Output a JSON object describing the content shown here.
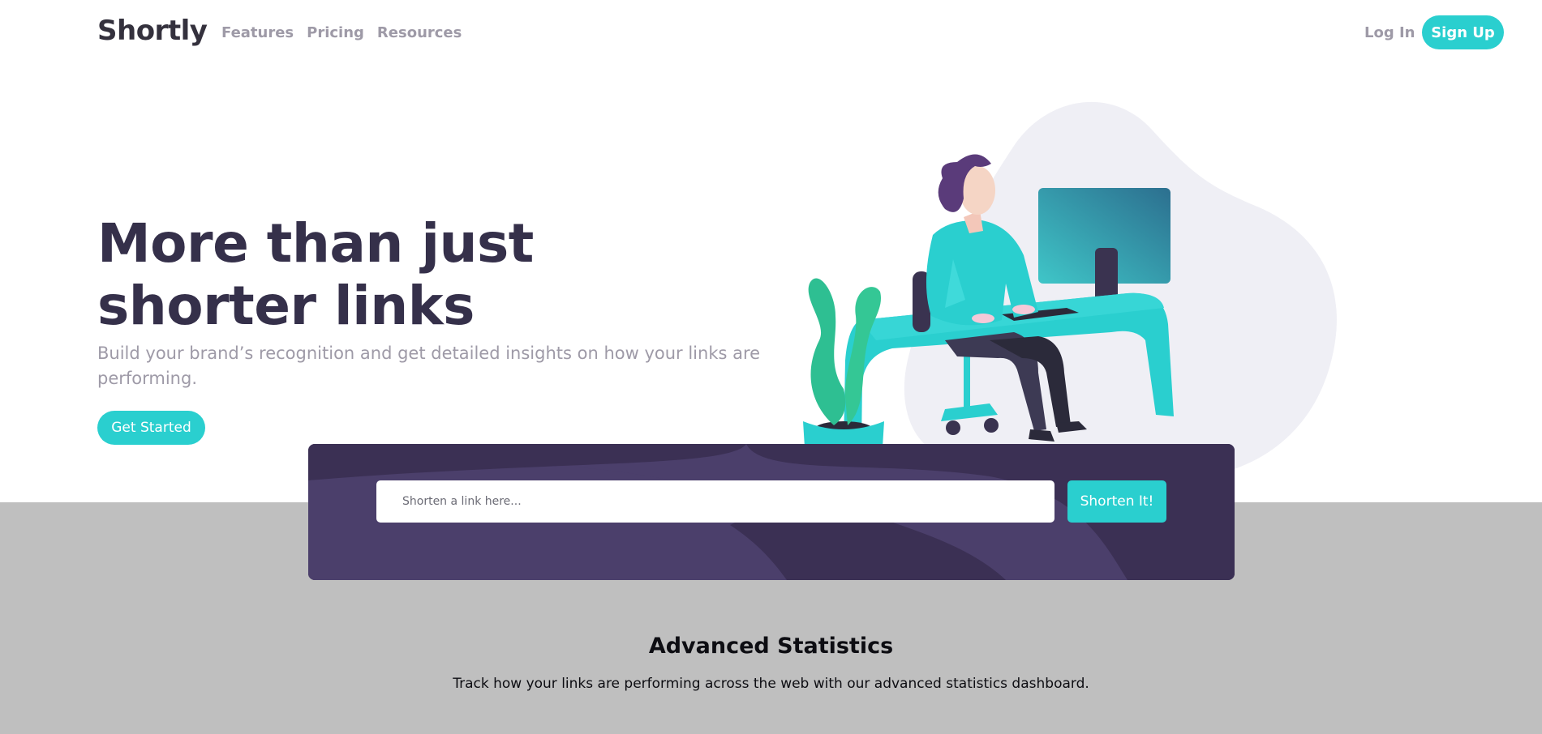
{
  "header": {
    "logo": "Shortly",
    "nav": [
      "Features",
      "Pricing",
      "Resources"
    ],
    "login_label": "Log In",
    "signup_label": "Sign Up"
  },
  "hero": {
    "title": "More than just shorter links",
    "subtitle": "Build your brand’s recognition and get detailed insights on how your links are performing.",
    "cta_label": "Get Started"
  },
  "shorten": {
    "placeholder": "Shorten a link here...",
    "button_label": "Shorten It!"
  },
  "stats": {
    "title": "Advanced Statistics",
    "description": "Track how your links are performing across the web with our advanced statistics dashboard."
  },
  "colors": {
    "accent": "#2acfcf",
    "dark_violet": "#3b3054",
    "gray_violet": "#9e9aa7"
  }
}
